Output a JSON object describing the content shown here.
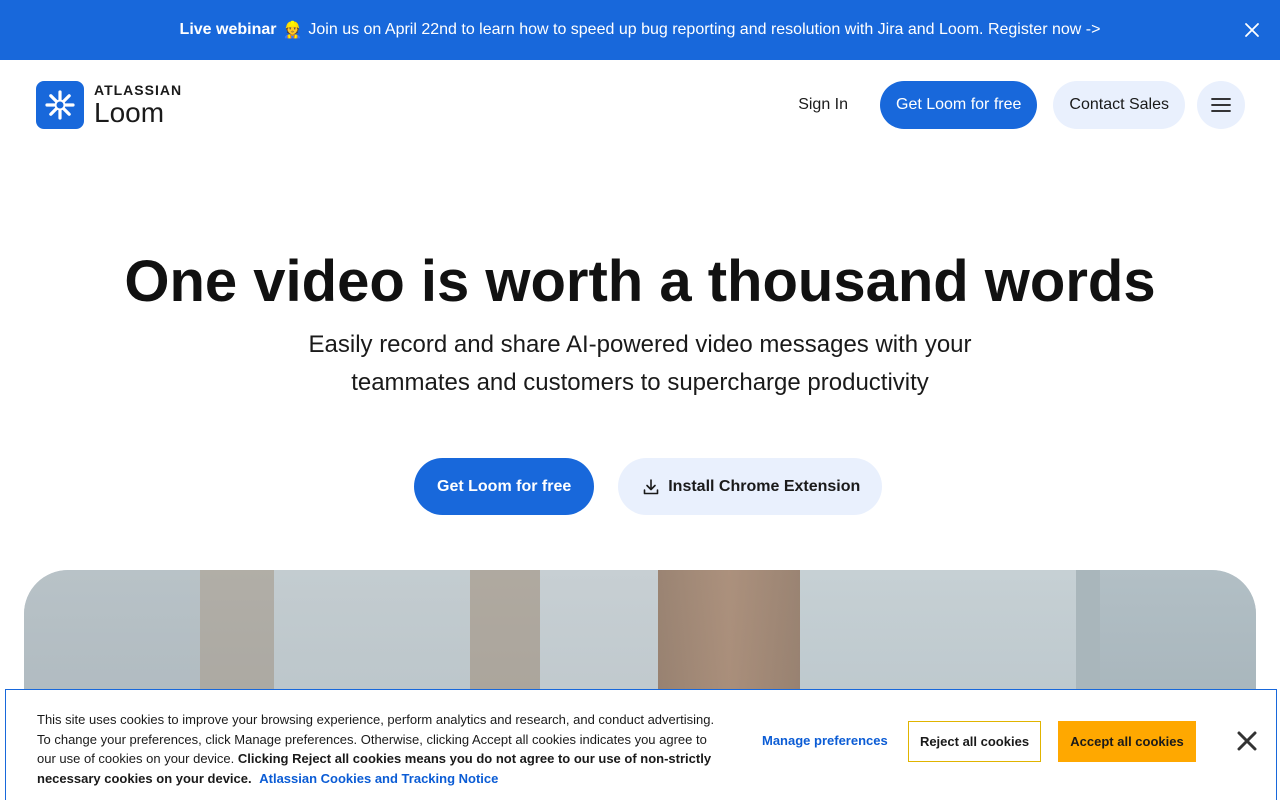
{
  "banner": {
    "bold": "Live webinar",
    "emoji": "👷",
    "message": "Join us on April 22nd to learn how to speed up bug reporting and resolution with Jira and Loom. Register now ->"
  },
  "header": {
    "logo_top": "ATLASSIAN",
    "logo_bottom": "Loom",
    "sign_in": "Sign In",
    "get_free": "Get Loom for free",
    "contact_sales": "Contact Sales"
  },
  "hero": {
    "title": "One video is worth a thousand words",
    "subtitle": "Easily record and share AI-powered video messages with your teammates and customers to supercharge productivity",
    "cta_primary": "Get Loom for free",
    "cta_secondary": "Install Chrome Extension"
  },
  "cookie": {
    "text_normal": "This site uses cookies to improve your browsing experience, perform analytics and research, and conduct advertising. To change your preferences, click Manage preferences. Otherwise, clicking Accept all cookies indicates you agree to our use of cookies on your device.",
    "text_bold": "Clicking Reject all cookies means you do not agree to our use of non-strictly necessary cookies on your device.",
    "link": "Atlassian Cookies and Tracking Notice",
    "manage": "Manage preferences",
    "reject": "Reject all cookies",
    "accept": "Accept all cookies"
  },
  "colors": {
    "brand": "#1868db",
    "accept": "#ffa800"
  }
}
